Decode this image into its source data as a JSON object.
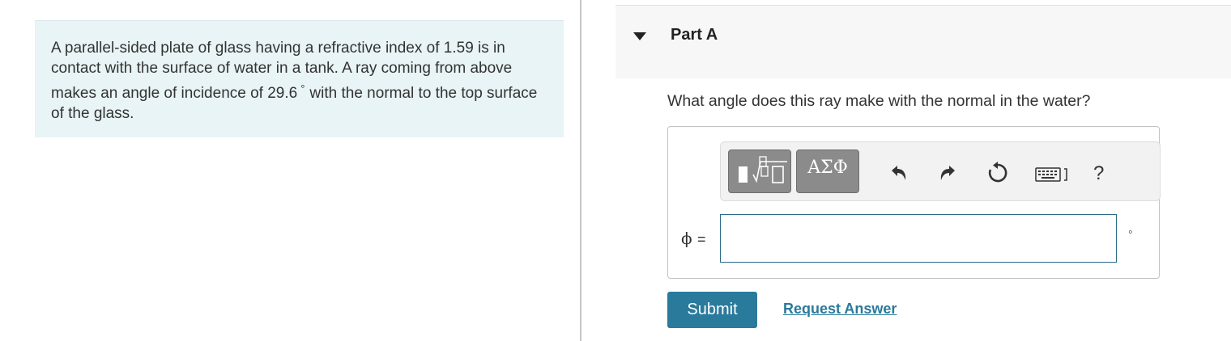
{
  "problem": {
    "text_before": "A parallel-sided plate of glass having a refractive index of 1.59 is in contact with the surface of water in a tank. A ray coming from above makes an angle of incidence of 29.6",
    "degree_symbol": "°",
    "text_after": "with the normal to the top surface of the glass."
  },
  "part": {
    "title": "Part A",
    "question": "What angle does this ray make with the normal in the water?"
  },
  "toolbar": {
    "greek_label": "ΑΣΦ",
    "help_label": "?",
    "icons": [
      "templates-icon",
      "greek-symbols-icon",
      "undo-icon",
      "redo-icon",
      "reset-icon",
      "keyboard-icon",
      "help-icon"
    ]
  },
  "answer": {
    "variable": "ϕ",
    "equals": "=",
    "value": "",
    "unit": "◦"
  },
  "actions": {
    "submit_label": "Submit",
    "request_label": "Request Answer"
  },
  "colors": {
    "problem_bg": "#e8f4f6",
    "accent": "#2a7a9c",
    "input_border": "#2a6b86",
    "toolbar_button": "#8b8b8b"
  }
}
